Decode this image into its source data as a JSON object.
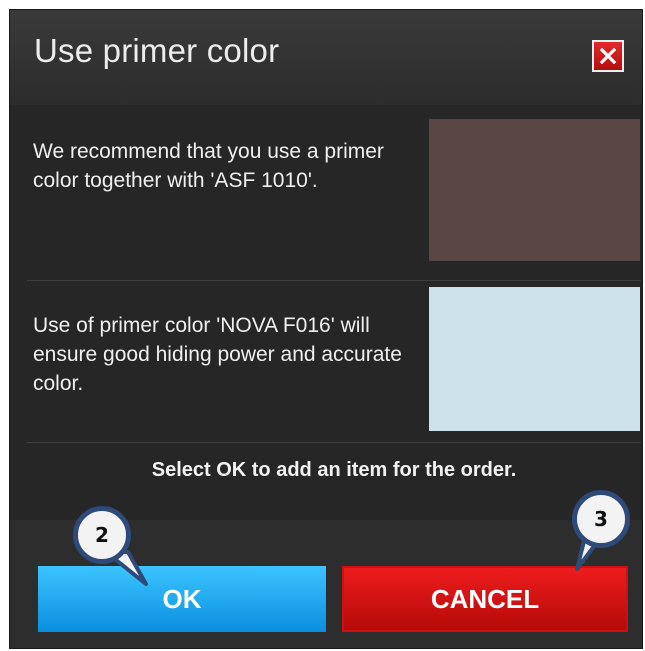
{
  "dialog": {
    "title": "Use primer color",
    "close_icon": "close-icon"
  },
  "recommendations": [
    {
      "text": "We recommend that you use a primer color together with 'ASF 1010'.",
      "swatch_color": "#5a4645"
    },
    {
      "text": "Use of primer color 'NOVA F016' will ensure good hiding power and accurate color.",
      "swatch_color": "#cde1ea"
    }
  ],
  "instruction": "Select OK to add an item for the order.",
  "buttons": {
    "ok_label": "OK",
    "cancel_label": "CANCEL"
  },
  "callouts": {
    "ok": "2",
    "cancel": "3"
  },
  "colors": {
    "dialog_bg": "#262626",
    "ok_button": "#1aa6f0",
    "cancel_button": "#d11414",
    "close_button": "#d11414",
    "callout_border": "#2e4a78"
  }
}
